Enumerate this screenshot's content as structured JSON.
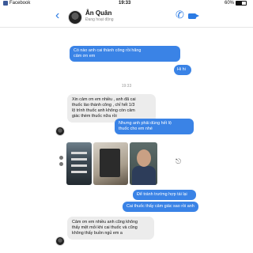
{
  "status_bar": {
    "carrier": "Facebook",
    "time": "19:33",
    "battery": "60%",
    "battery_level": 0.6
  },
  "header": {
    "contact_name": "Ân Quân",
    "contact_status": "Đang hoạt động"
  },
  "messages": [
    {
      "side": "out",
      "text_lines": [
        "Có nào anh cai thành công rồi hãng",
        "cảm ơn em"
      ]
    },
    {
      "side": "out",
      "text_lines": [
        "Hi hi"
      ]
    },
    {
      "side": "in",
      "text_lines": [
        "Xin cảm ơn em nhiều , anh đã cai",
        "thuốc lào thành công , chỉ hết 1/3",
        "lộ trình thuốc  anh không còn cảm",
        "giác thèm thuốc nữa rồi"
      ]
    },
    {
      "side": "out",
      "text_lines": [
        "Nhưng anh phải dùng hết lộ",
        "thuốc cho em nhé"
      ]
    },
    {
      "side": "out",
      "text_lines": [
        "Để tránh trường hợp tái lại"
      ]
    },
    {
      "side": "out",
      "text_lines": [
        "Cai thuốc thấy cảm giác sao rồi anh"
      ]
    },
    {
      "side": "in",
      "text_lines": [
        "Cảm ơn em nhiều anh cũng không",
        "thấy mệt mỏi khi cai thuốc và cũng",
        "không thấy buồn ngủ em a"
      ]
    }
  ],
  "timestamp": "19:33"
}
